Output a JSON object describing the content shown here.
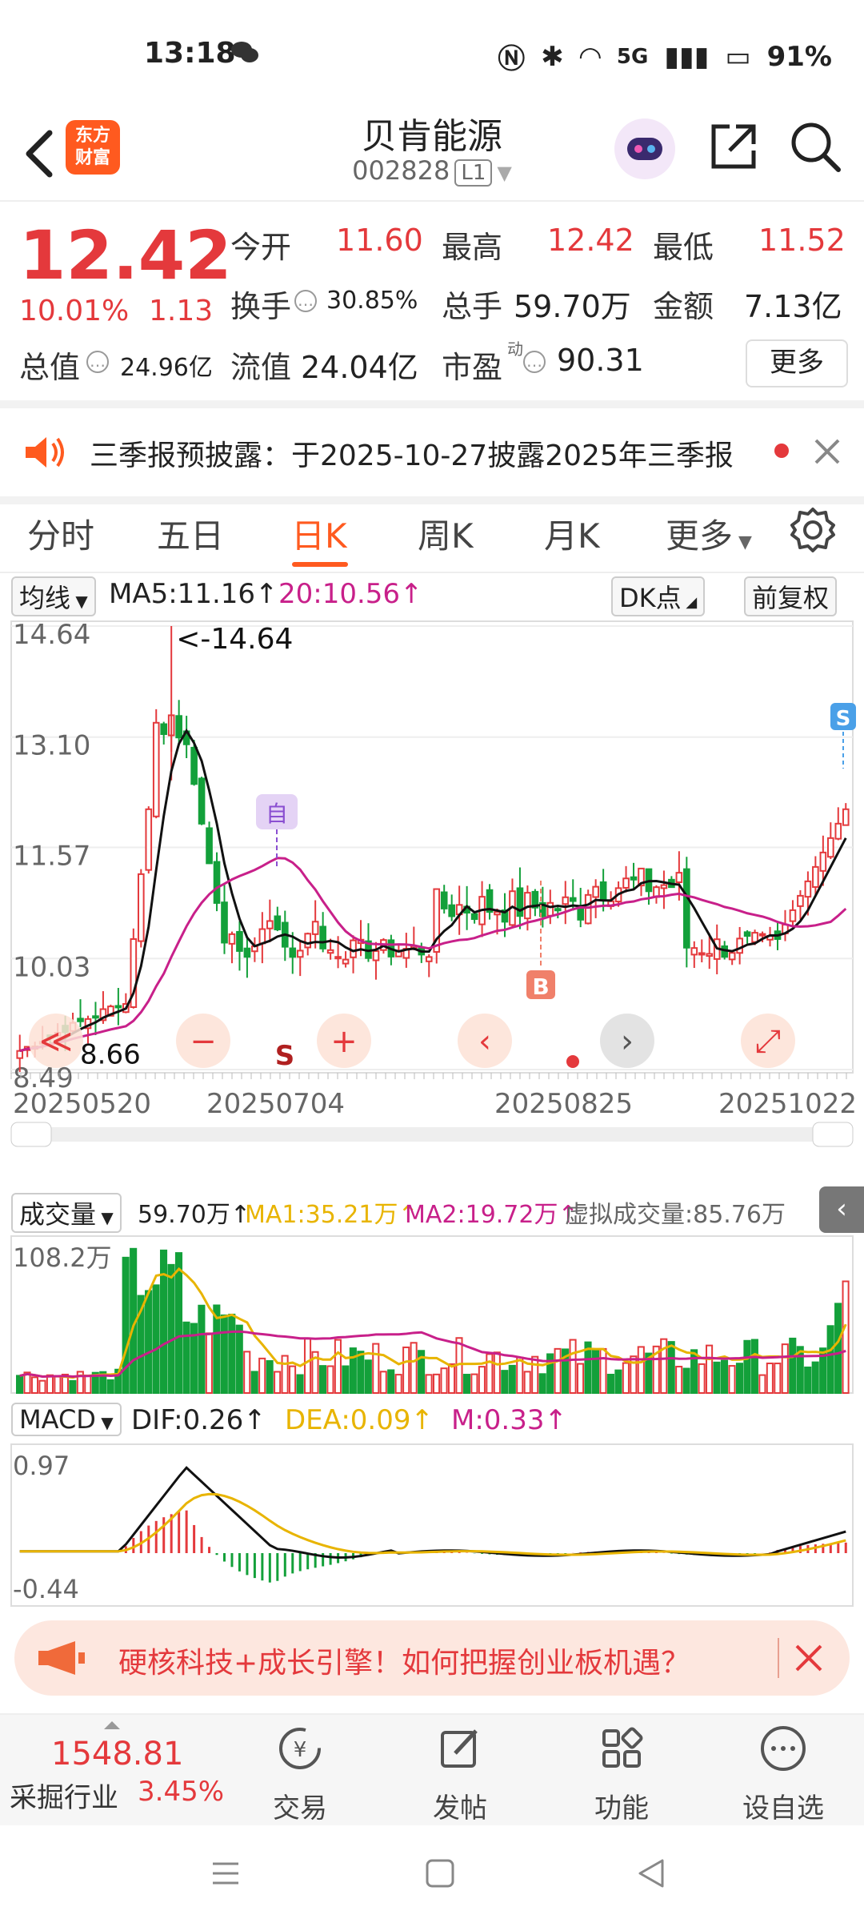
{
  "status": {
    "time": "13:18",
    "network": "5G",
    "battery": "91%"
  },
  "header": {
    "title": "贝肯能源",
    "code": "002828",
    "level": "L1",
    "logo_text": "东方\n财富"
  },
  "quote": {
    "price": "12.42",
    "pct": "10.01%",
    "change": "1.13",
    "open_label": "今开",
    "open": "11.60",
    "high_label": "最高",
    "high": "12.42",
    "low_label": "最低",
    "low": "11.52",
    "turnover_label": "换手",
    "turnover": "30.85%",
    "volume_label": "总手",
    "volume": "59.70万",
    "amount_label": "金额",
    "amount": "7.13亿",
    "mcap_label": "总值",
    "mcap": "24.96亿",
    "float_label": "流值",
    "float": "24.04亿",
    "pe_label": "市盈",
    "pe_sup": "动",
    "pe": "90.31",
    "more": "更多"
  },
  "notice": {
    "text": "三季报预披露：于2025-10-27披露2025年三季报"
  },
  "tabs": [
    "分时",
    "五日",
    "日K",
    "周K",
    "月K",
    "更多"
  ],
  "tabs_active": 2,
  "kline": {
    "ma_selector": "均线",
    "ma5": "MA5:11.16↑",
    "ma20": "20:10.56↑",
    "dk": "DK点",
    "adjust": "前复权",
    "y_ticks": [
      "14.64",
      "13.10",
      "11.57",
      "10.03",
      "8.49"
    ],
    "peak_label": "<-14.64",
    "low_label": "8.66",
    "x_ticks": [
      "20250520",
      "20250704",
      "20250825",
      "20251022"
    ],
    "marker_zi": "自",
    "marker_b": "B",
    "marker_s": "S",
    "marker_s2": "S"
  },
  "volume": {
    "selector": "成交量",
    "val": "59.70万↑",
    "ma1": "MA1:35.21万↑",
    "ma2": "MA2:19.72万↑",
    "virtual": "虚拟成交量:85.76万",
    "y_top": "108.2万"
  },
  "macd": {
    "selector": "MACD",
    "dif": "DIF:0.26↑",
    "dea": "DEA:0.09↑",
    "m": "M:0.33↑",
    "y_top": "0.97",
    "y_bot": "-0.44"
  },
  "ad": {
    "text": "硬核科技+成长引擎！如何把握创业板机遇？"
  },
  "bottom": {
    "index_value": "1548.81",
    "index_name": "采掘行业",
    "index_pct": "3.45%",
    "items": [
      "交易",
      "发帖",
      "功能",
      "设自选"
    ]
  },
  "colors": {
    "up": "#e4393c",
    "down": "#13a03a",
    "accent": "#ff5a1f",
    "ma5": "#000000",
    "ma20": "#c8208a",
    "ma_vol1": "#e8b400"
  }
}
